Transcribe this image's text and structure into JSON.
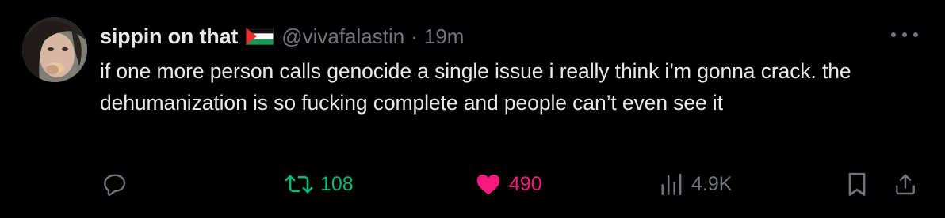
{
  "tweet": {
    "author": {
      "display_name": "sippin on that",
      "handle": "@vivafalastin",
      "flag_icon": "palestine-flag-icon"
    },
    "separator": "·",
    "timestamp": "19m",
    "text": "if one more person calls genocide a single issue i really think i’m gonna crack. the dehumanization is so fucking complete and people can’t even see it",
    "actions": {
      "reply_icon": "reply-icon",
      "retweet_count": "108",
      "like_count": "490",
      "views_count": "4.9K",
      "bookmark_icon": "bookmark-icon",
      "share_icon": "share-icon",
      "more_icon": "more-icon"
    },
    "colors": {
      "background": "#000000",
      "text": "#e7e9ea",
      "secondary": "#71767b",
      "retweet": "#00ba7c",
      "like": "#f91880"
    }
  }
}
